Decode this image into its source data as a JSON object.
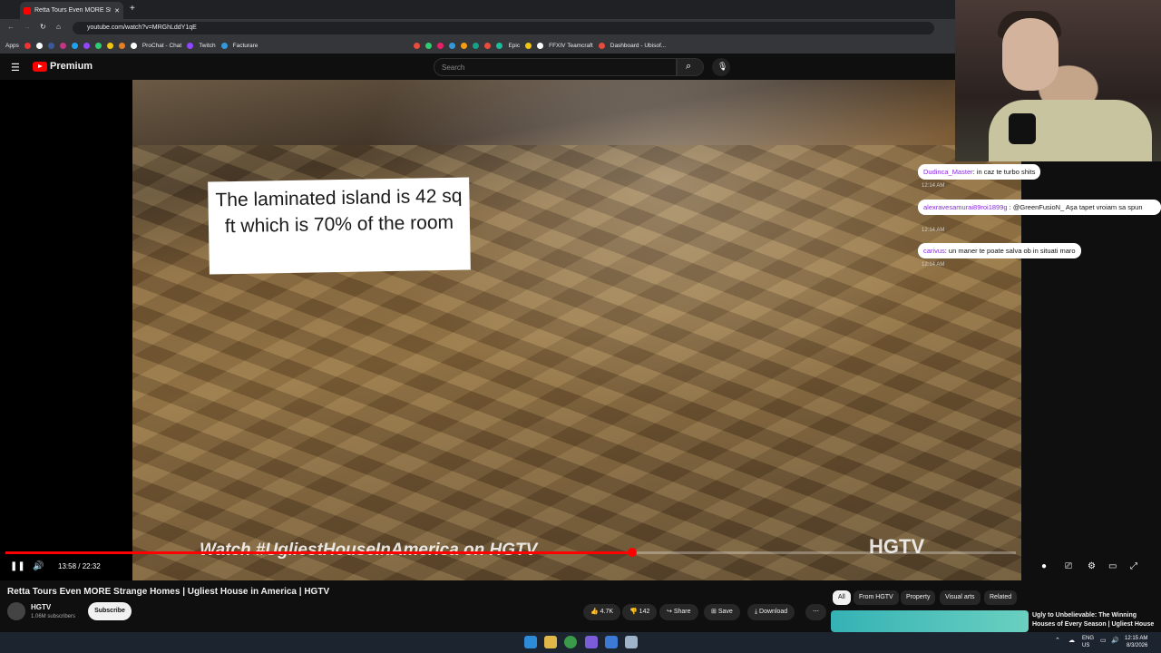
{
  "browser": {
    "tab_title": "Retta Tours Even MORE Strange Homes",
    "url": "youtube.com/watch?v=MRGhLddY1qE",
    "bookmarks": [
      "Apps",
      "ProChat - Chat",
      "Twitch",
      "Facturare",
      "Epic",
      "FFXIV Teamcraft",
      "Dashboard - Ubisof..."
    ]
  },
  "youtube": {
    "logo_text": "Premium",
    "search_placeholder": "Search"
  },
  "video": {
    "caption": "The laminated island is 42 sq ft which is 70% of the room",
    "watermark": "Watch #UgliestHouseInAmerica on HGTV",
    "network_logo": "HGTV",
    "time": "13:58 / 22:32",
    "progress": 0.62
  },
  "chat": [
    {
      "name": "Dudinca_Master",
      "text": ": in caz te turbo shits",
      "time": "12:14 AM"
    },
    {
      "name": "alexravesamurai89roi1899g",
      "text": ": @GreenFusioN_ Aşa tapet vroiam sa spun",
      "time": "12:14 AM"
    },
    {
      "name": "carivus",
      "text": ": un maner te poate salva ob in situati maro",
      "time": "12:14 AM"
    }
  ],
  "meta": {
    "title": "Retta Tours Even MORE Strange Homes | Ugliest House in America | HGTV",
    "channel": "HGTV",
    "subscribers": "1.06M subscribers",
    "subscribe_label": "Subscribe",
    "likes": "4.7K",
    "dislikes": "142",
    "share": "Share",
    "save": "Save",
    "download": "Download"
  },
  "chips": [
    "All",
    "From HGTV",
    "Property",
    "Visual arts",
    "Related"
  ],
  "next_video": {
    "title": "Ugly to Unbelievable: The Winning Houses of Every Season | Ugliest House"
  },
  "taskbar": {
    "lang": "ENG\nUS",
    "time": "12:15 AM",
    "date": "8/3/2026"
  }
}
